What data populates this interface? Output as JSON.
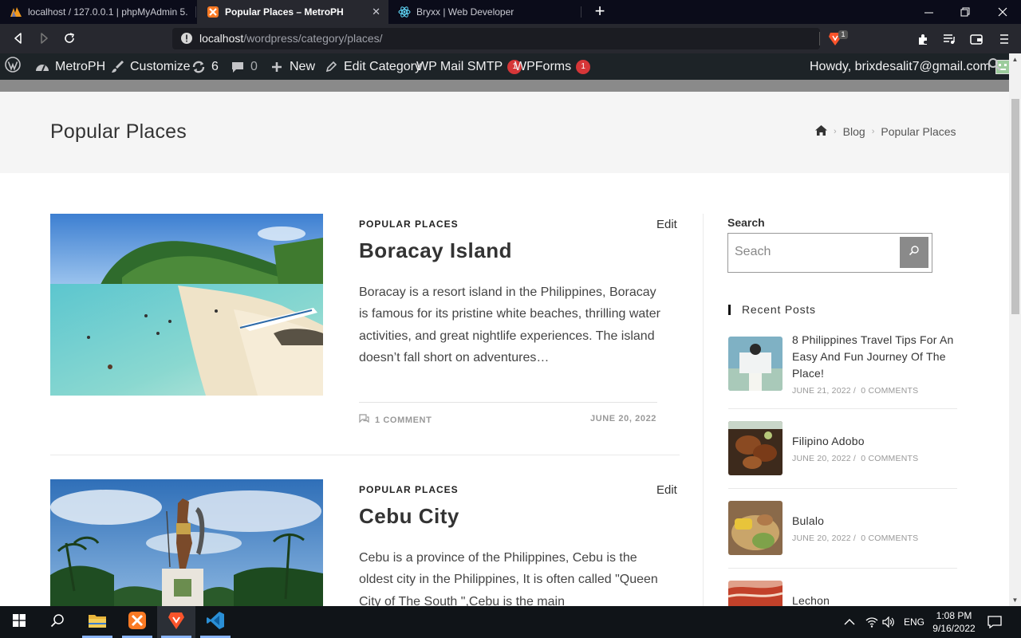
{
  "browser": {
    "tabs": [
      {
        "title": "localhost / 127.0.0.1 | phpMyAdmin 5.",
        "icon": "phpmyadmin-icon",
        "active": false
      },
      {
        "title": "Popular Places – MetroPH",
        "icon": "xampp-icon",
        "active": true
      },
      {
        "title": "Bryxx | Web Developer",
        "icon": "react-icon",
        "active": false
      }
    ],
    "url_host": "localhost",
    "url_path": "/wordpress/category/places/",
    "brave_badge": "1"
  },
  "adminbar": {
    "site": "MetroPH",
    "customize": "Customize",
    "updates": "6",
    "comments": "0",
    "new": "New",
    "edit_category": "Edit Category",
    "wp_mail_smtp": "WP Mail SMTP",
    "wp_mail_smtp_badge": "1",
    "wpforms": "WPForms",
    "wpforms_badge": "1",
    "howdy": "Howdy, brixdesalit7@gmail.com"
  },
  "page": {
    "title": "Popular Places",
    "breadcrumb": [
      "Blog",
      "Popular Places"
    ]
  },
  "posts": [
    {
      "category": "POPULAR PLACES",
      "edit": "Edit",
      "title": "Boracay Island",
      "excerpt": "Boracay is a resort island in the Philippines, Boracay is famous for its pristine white beaches, thrilling water activities, and great nightlife experiences. The island doesn’t fall short on adventures…",
      "comments": "1 COMMENT",
      "date": "JUNE 20, 2022"
    },
    {
      "category": "POPULAR PLACES",
      "edit": "Edit",
      "title": "Cebu City",
      "excerpt": "Cebu is a province of the Philippines, Cebu is the oldest city in the Philippines, It is often called \"Queen City of The South \",Cebu is the main"
    }
  ],
  "sidebar": {
    "search_label": "Search",
    "search_placeholder": "Seach",
    "recent_title": "Recent Posts",
    "recent_posts": [
      {
        "title": "8 Philippines Travel Tips For An Easy And Fun Journey Of The Place!",
        "date": "JUNE 21, 2022",
        "comments": "0 COMMENTS"
      },
      {
        "title": "Filipino Adobo",
        "date": "JUNE 20, 2022",
        "comments": "0 COMMENTS"
      },
      {
        "title": "Bulalo",
        "date": "JUNE 20, 2022",
        "comments": "0 COMMENTS"
      },
      {
        "title": "Lechon"
      }
    ]
  },
  "taskbar": {
    "lang": "ENG",
    "time": "1:08 PM",
    "date": "9/16/2022"
  }
}
